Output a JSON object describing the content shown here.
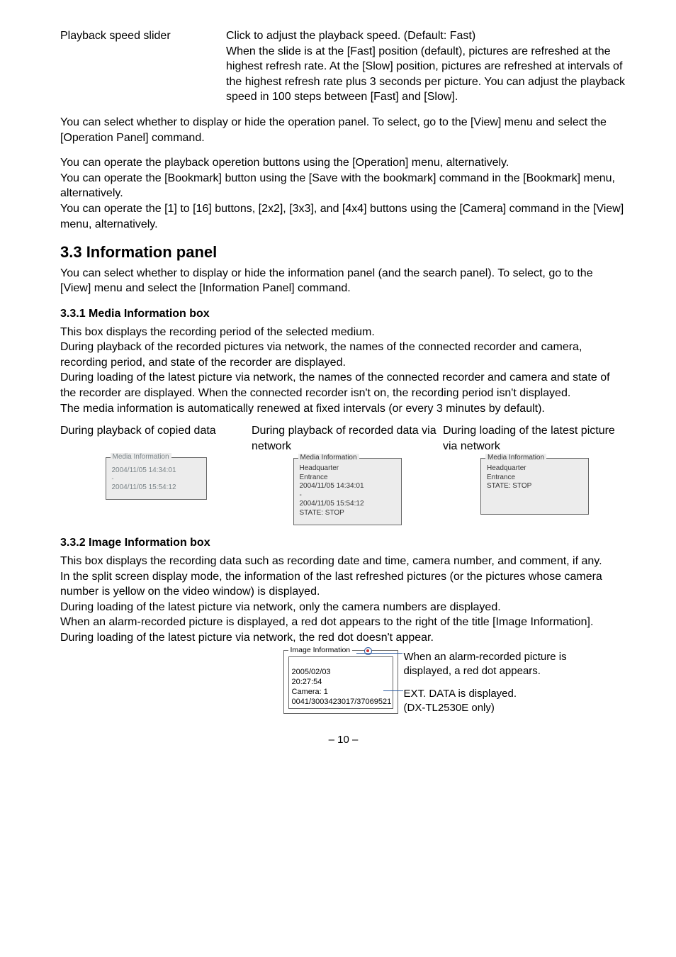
{
  "def": {
    "label": "Playback speed slider",
    "body": "Click to adjust the playback speed. (Default: Fast)\nWhen the slide is at the [Fast] position (default), pictures are refreshed at the highest refresh rate.  At the [Slow] position, pictures are refreshed at intervals of the highest refresh rate plus 3 seconds per picture.  You can adjust the playback speed in 100 steps between [Fast] and [Slow]."
  },
  "p1": "You can select whether to display or hide the operation panel. To select, go to the [View] menu and select the [Operation Panel] command.",
  "p2a": "You can operate the playback operetion buttons using the [Operation] menu, alternatively.",
  "p2b": "You can operate the [Bookmark] button using the [Save with the bookmark] command in the [Bookmark] menu, alternatively.",
  "p2c": "You can operate the [1] to [16] buttons, [2x2], [3x3], and [4x4] buttons using the [Camera] command in the [View] menu, alternatively.",
  "s33_title": "3.3 Information panel",
  "s33_body": "You can select whether to display or hide the information panel (and the search panel). To select, go to the [View] menu and select the [Information Panel] command.",
  "s331_title": "3.3.1 Media Information box",
  "s331_a": "This box displays the recording period of the selected medium.",
  "s331_b": "During playback of the recorded pictures via network, the names of the connected recorder and camera, recording period, and state of the recorder are displayed.",
  "s331_c": "During loading of the latest picture via network, the names of the connected recorder and camera and state of the recorder are displayed.  When the connected recorder isn't on, the recording period isn't displayed.",
  "s331_d": "The media information is automatically renewed at fixed intervals (or every 3 minutes by default).",
  "col_labels": {
    "a": "During playback of copied data",
    "b": "During playback of recorded data via network",
    "c": "During loading of the latest picture via network"
  },
  "box1": {
    "legend": "Media Information",
    "l1": "2004/11/05 14:34:01",
    "l2": "2004/11/05 15:54:12"
  },
  "box2": {
    "legend": "Media Information",
    "l1": "Headquarter",
    "l2": "Entrance",
    "l3": "2004/11/05 14:34:01",
    "l4": "-",
    "l5": "2004/11/05 15:54:12",
    "l6": "STATE: STOP"
  },
  "box3": {
    "legend": "Media Information",
    "l1": "Headquarter",
    "l2": "Entrance",
    "l3": "STATE: STOP"
  },
  "s332_title": "3.3.2 Image Information box",
  "s332_a": "This box displays the recording data such as recording date and  time, camera number, and comment, if any.",
  "s332_b": "In the split screen display mode, the information of the last refreshed pictures (or the pictures whose camera number is yellow on the video window) is displayed.",
  "s332_c": "During loading of the latest picture via network, only the camera numbers are displayed.",
  "s332_d": "When an alarm-recorded picture is displayed, a red dot appears to the right of the title [Image Information].",
  "s332_e": "During loading of the latest picture via network, the red dot doesn't appear.",
  "imgbox": {
    "legend": "Image Information",
    "l1": "2005/02/03",
    "l2": "20:27:54",
    "l3": "Camera: 1",
    "l4": "0041/3003423017/37069521"
  },
  "callout1": "When an alarm-recorded picture is displayed, a red dot appears.",
  "callout2a": "EXT. DATA is displayed.",
  "callout2b": "(DX-TL2530E only)",
  "pagenum": "– 10 –"
}
